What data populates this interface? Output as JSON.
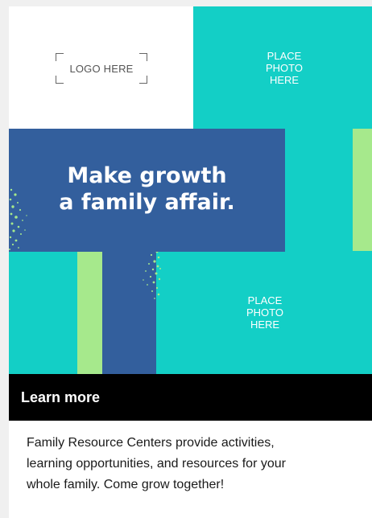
{
  "logo": {
    "placeholder": "LOGO HERE"
  },
  "photo_top": {
    "lines": [
      "PLACE",
      "PHOTO",
      "HERE"
    ]
  },
  "photo_bottom": {
    "lines": [
      "PLACE",
      "PHOTO",
      "HERE"
    ]
  },
  "headline": {
    "lines": [
      "Make growth",
      "a family affair."
    ]
  },
  "cta": {
    "label": "Learn more"
  },
  "description": {
    "lines": [
      "Family Resource Centers provide activities,",
      "learning opportunities, and resources for your",
      "whole family. Come grow together!"
    ]
  },
  "colors": {
    "teal": "#13cfc6",
    "blue": "#335f9d",
    "green": "#a6e98c",
    "black": "#000000",
    "white": "#ffffff"
  }
}
